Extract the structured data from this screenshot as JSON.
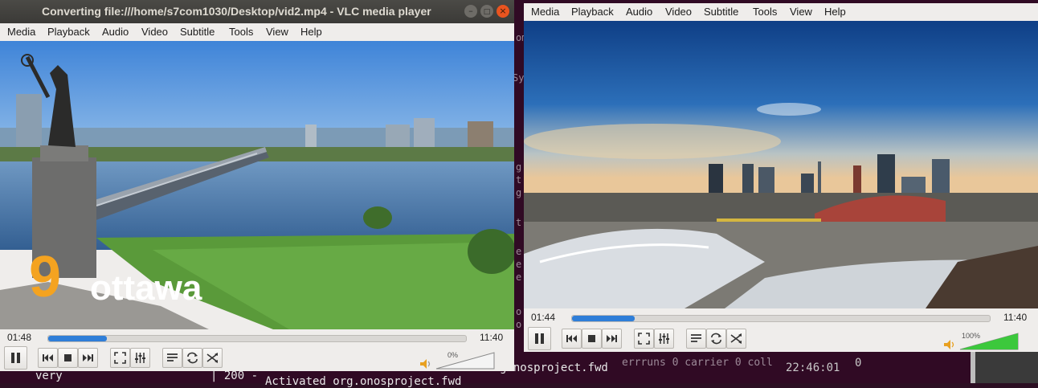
{
  "terminal": {
    "line_very": "very",
    "line_200": "| 200 -",
    "line_activated": "Activated org.onosproject.fwd",
    "frag_onos": "gonosproject.fwd",
    "frag_errs": "errruns 0  carrier 0  coll",
    "frag_time": "22:46:01",
    "frag_zero": "0"
  },
  "vlc1": {
    "title": "Converting file:///home/s7com1030/Desktop/vid2.mp4 - VLC media player",
    "menu": [
      "Media",
      "Playback",
      "Audio",
      "Video",
      "Subtitle",
      "Tools",
      "View",
      "Help"
    ],
    "time_elapsed": "01:48",
    "time_total": "11:40",
    "progress": 0.14,
    "volume_label": "0%",
    "volume": 0,
    "overlay_number": "9",
    "overlay_word": "ottawa"
  },
  "vlc2": {
    "menu": [
      "Media",
      "Playback",
      "Audio",
      "Video",
      "Subtitle",
      "Tools",
      "View",
      "Help"
    ],
    "time_elapsed": "01:44",
    "time_total": "11:40",
    "progress": 0.15,
    "volume_label": "100%",
    "volume": 1.0
  },
  "icons": {
    "pause": "pause-icon",
    "prev": "previous-icon",
    "stop": "stop-icon",
    "next": "next-icon",
    "fullscreen": "fullscreen-icon",
    "ext": "extended-settings-icon",
    "playlist": "playlist-icon",
    "loop": "loop-icon",
    "random": "shuffle-icon",
    "volume": "speaker-icon"
  },
  "colors": {
    "accent": "#2f7ed8",
    "volume_fill": "#3cc83c",
    "close_button": "#e9541f"
  }
}
